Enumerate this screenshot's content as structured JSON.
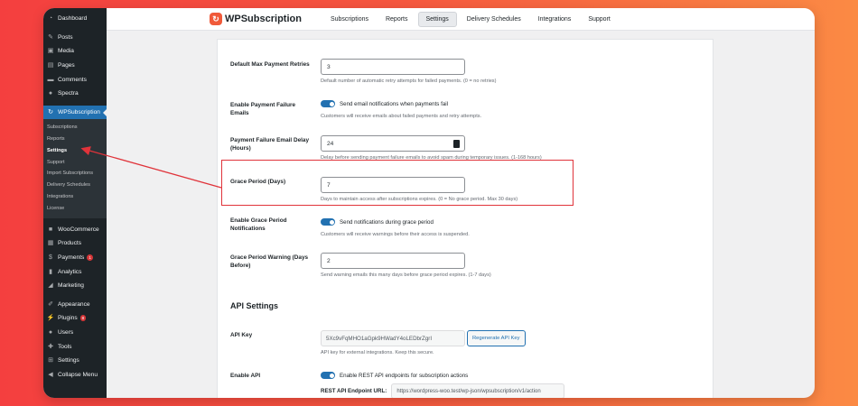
{
  "sidebar": {
    "main_items": [
      {
        "label": "Dashboard",
        "icon": "dashboard-icon"
      },
      {
        "label": "Posts",
        "icon": "pin-icon"
      },
      {
        "label": "Media",
        "icon": "media-icon"
      },
      {
        "label": "Pages",
        "icon": "pages-icon"
      },
      {
        "label": "Comments",
        "icon": "comments-icon"
      },
      {
        "label": "Spectra",
        "icon": "spectra-icon"
      }
    ],
    "active_item": {
      "label": "WPSubscription",
      "icon": "subscription-icon"
    },
    "submenu": [
      "Subscriptions",
      "Reports",
      "Settings",
      "Support",
      "Import Subscriptions",
      "Delivery Schedules",
      "Integrations",
      "License"
    ],
    "current_submenu": "Settings",
    "commerce_items": [
      {
        "label": "WooCommerce",
        "icon": "woo-icon"
      },
      {
        "label": "Products",
        "icon": "products-icon"
      },
      {
        "label": "Payments",
        "icon": "payments-icon",
        "badge": "1"
      },
      {
        "label": "Analytics",
        "icon": "analytics-icon"
      },
      {
        "label": "Marketing",
        "icon": "marketing-icon"
      }
    ],
    "admin_items": [
      {
        "label": "Appearance",
        "icon": "appearance-icon"
      },
      {
        "label": "Plugins",
        "icon": "plugins-icon",
        "badge": "8"
      },
      {
        "label": "Users",
        "icon": "users-icon"
      },
      {
        "label": "Tools",
        "icon": "tools-icon"
      },
      {
        "label": "Settings",
        "icon": "settings-icon"
      },
      {
        "label": "Collapse Menu",
        "icon": "collapse-icon"
      }
    ]
  },
  "topnav": {
    "brand": "WPSubscription",
    "tabs": [
      "Subscriptions",
      "Reports",
      "Settings",
      "Delivery Schedules",
      "Integrations",
      "Support"
    ],
    "active_tab": "Settings"
  },
  "settings": {
    "max_retries": {
      "label": "Default Max Payment Retries",
      "value": "3",
      "desc": "Default number of automatic retry attempts for failed payments. (0 = no retries)"
    },
    "failure_emails": {
      "label": "Enable Payment Failure Emails",
      "toggle_text": "Send email notifications when payments fail",
      "desc": "Customers will receive emails about failed payments and retry attempts.",
      "enabled": true
    },
    "failure_delay": {
      "label": "Payment Failure Email Delay (Hours)",
      "value": "24",
      "desc": "Delay before sending payment failure emails to avoid spam during temporary issues. (1-168 hours)"
    },
    "grace_period": {
      "label": "Grace Period (Days)",
      "value": "7",
      "desc": "Days to maintain access after subscriptions expires. (0 = No grace period. Max 30 days)"
    },
    "grace_notifications": {
      "label": "Enable Grace Period Notifications",
      "toggle_text": "Send notifications during grace period",
      "desc": "Customers will receive warnings before their access is suspended.",
      "enabled": true
    },
    "grace_warning": {
      "label": "Grace Period Warning (Days Before)",
      "value": "2",
      "desc": "Send warning emails this many days before grace period expires. (1-7 days)"
    }
  },
  "api": {
    "section_title": "API Settings",
    "key_label": "API Key",
    "key_value": "5Xc9vFqMHO1aGpk9HWadY4oLEDbrZgrI",
    "regenerate_label": "Regenerate API Key",
    "key_desc": "API key for external integrations. Keep this secure.",
    "enable_label": "Enable API",
    "enable_text": "Enable REST API endpoints for subscription actions",
    "enabled": true,
    "endpoint_label": "REST API Endpoint URL:",
    "endpoint_value": "https://wordpress-woo.test/wp-json/wpsubscription/v1/action"
  },
  "colors": {
    "accent": "#2271b1",
    "highlight": "#e0333a",
    "brand": "#f05a3a",
    "sidebar": "#1d2327"
  }
}
